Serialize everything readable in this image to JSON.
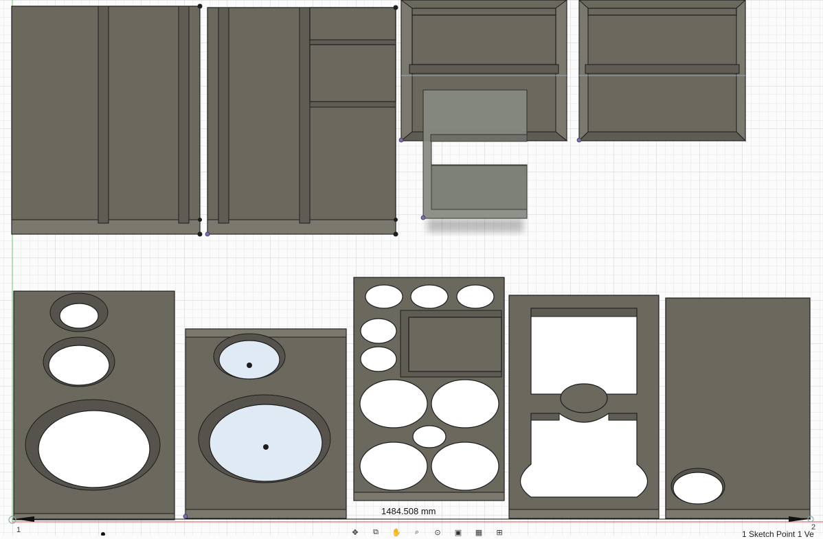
{
  "dimension": {
    "value_label": "1484.508 mm"
  },
  "axis_labels": {
    "left": "1",
    "right": "2"
  },
  "status": {
    "text": "1 Sketch Point 1 Ve"
  },
  "toolbar": [
    {
      "icon": "orbit-icon",
      "glyph": "✥"
    },
    {
      "icon": "look-at-icon",
      "glyph": "⧉"
    },
    {
      "icon": "pan-icon",
      "glyph": "✋"
    },
    {
      "icon": "zoom-icon",
      "glyph": "⌕"
    },
    {
      "icon": "fit-icon",
      "glyph": "⊙"
    },
    {
      "icon": "display-settings-icon",
      "glyph": "▣"
    },
    {
      "icon": "grid-settings-icon",
      "glyph": "▦"
    },
    {
      "icon": "viewports-icon",
      "glyph": "⊞"
    }
  ],
  "colors": {
    "panel": "#6b685e",
    "grid_minor": "#e3e3e3",
    "grid_major": "#cfcfcf",
    "origin_axis_green": "#7ed07e",
    "origin_axis_red": "#e07070",
    "selection": "#dfeaf4"
  }
}
